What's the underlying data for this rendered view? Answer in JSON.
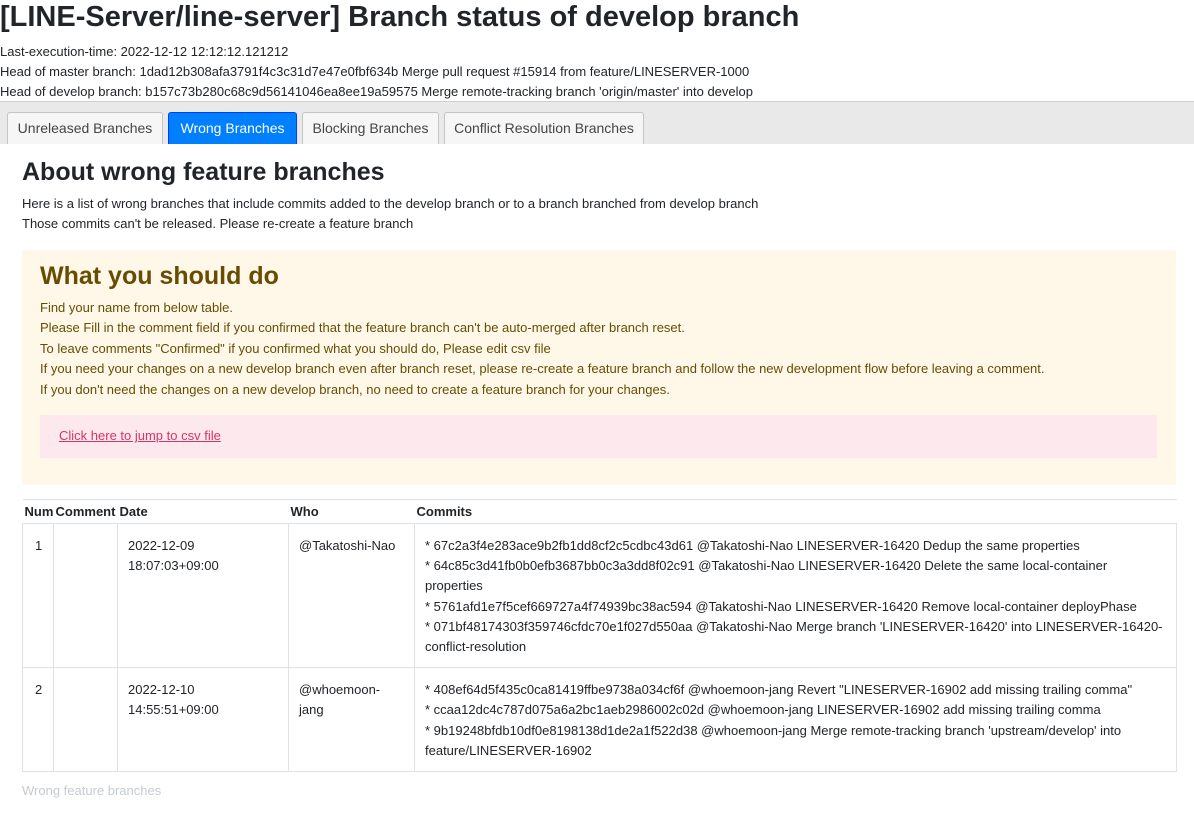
{
  "page": {
    "title": "[LINE-Server/line-server] Branch status of develop branch",
    "meta": {
      "last_execution": "Last-execution-time: 2022-12-12 12:12:12.121212",
      "master_head": "Head of master branch: 1dad12b308afa3791f4c3c31d7e47e0fbf634b Merge pull request #15914 from feature/LINESERVER-1000",
      "develop_head": "Head of develop branch: b157c73b280c68c9d56141046ea8ee19a59575 Merge remote-tracking branch 'origin/master' into develop"
    }
  },
  "tabs": [
    {
      "label": "Unreleased Branches",
      "active": false
    },
    {
      "label": "Wrong Branches",
      "active": true
    },
    {
      "label": "Blocking Branches",
      "active": false
    },
    {
      "label": "Conflict Resolution Branches",
      "active": false
    }
  ],
  "section": {
    "heading": "About wrong feature branches",
    "intro": [
      "Here is a list of wrong branches that include commits added to the develop branch or to a branch branched from develop branch",
      "Those commits can't be released. Please re-create a feature branch"
    ]
  },
  "callout": {
    "title": "What you should do",
    "lines": [
      "Find your name from below table.",
      "Please Fill in the comment field if you confirmed that the feature branch can't be auto-merged after branch reset.",
      "To leave comments \"Confirmed\" if you confirmed what you should do, Please edit csv file",
      "If you need your changes on a new develop branch even after branch reset, please re-create a feature branch and follow the new development flow before leaving a comment.",
      "If you don't need the changes on a new develop branch, no need to create a feature branch for your changes."
    ],
    "link_label": "Click here to jump to csv file"
  },
  "table": {
    "headers": [
      "Num",
      "Comment",
      "Date",
      "Who",
      "Commits"
    ],
    "rows": [
      {
        "num": "1",
        "comment": "",
        "date_day": "2022-12-09",
        "date_time": "18:07:03+09:00",
        "who": "@Takatoshi-Nao",
        "commits": [
          "* 67c2a3f4e283ace9b2fb1dd8cf2c5cdbc43d61 @Takatoshi-Nao LINESERVER-16420 Dedup the same properties",
          "* 64c85c3d41fb0b0efb3687bb0c3a3dd8f02c91 @Takatoshi-Nao LINESERVER-16420 Delete the same local-container properties",
          "* 5761afd1e7f5cef669727a4f74939bc38ac594 @Takatoshi-Nao LINESERVER-16420 Remove local-container deployPhase",
          "* 071bf48174303f359746cfdc70e1f027d550aa @Takatoshi-Nao Merge branch 'LINESERVER-16420' into LINESERVER-16420-conflict-resolution"
        ]
      },
      {
        "num": "2",
        "comment": "",
        "date_day": "2022-12-10",
        "date_time": "14:55:51+09:00",
        "who": "@whoemoon-jang",
        "commits": [
          "* 408ef64d5f435c0ca81419ffbe9738a034cf6f @whoemoon-jang Revert \"LINESERVER-16902 add missing trailing comma\"",
          "* ccaa12dc4c787d075a6a2bc1aeb2986002c02d @whoemoon-jang LINESERVER-16902 add missing trailing comma",
          "* 9b19248bfdb10df0e8198138d1de2a1f522d38 @whoemoon-jang Merge remote-tracking branch 'upstream/develop' into feature/LINESERVER-16902"
        ]
      }
    ]
  },
  "footer": {
    "note": "Wrong feature branches"
  }
}
